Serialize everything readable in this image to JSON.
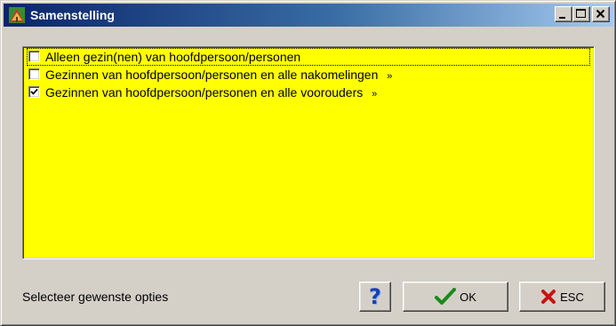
{
  "window": {
    "title": "Samenstelling",
    "app_icon": "family-tree-icon",
    "controls": [
      "minimize-icon",
      "maximize-icon",
      "close-icon"
    ]
  },
  "options": [
    {
      "label": "Alleen gezin(nen) van hoofdpersoon/personen",
      "checked": false,
      "focused": true,
      "more": ""
    },
    {
      "label": "Gezinnen van hoofdpersoon/personen en alle nakomelingen",
      "checked": false,
      "focused": false,
      "more": "»"
    },
    {
      "label": "Gezinnen van hoofdpersoon/personen en alle voorouders",
      "checked": true,
      "focused": false,
      "more": "»"
    }
  ],
  "listbox_background": "#ffff00",
  "status": "Selecteer gewenste opties",
  "buttons": {
    "help_icon": "help-question-icon",
    "ok_label": "OK",
    "ok_icon": "green-checkmark-icon",
    "esc_label": "ESC",
    "esc_icon": "red-x-icon"
  }
}
